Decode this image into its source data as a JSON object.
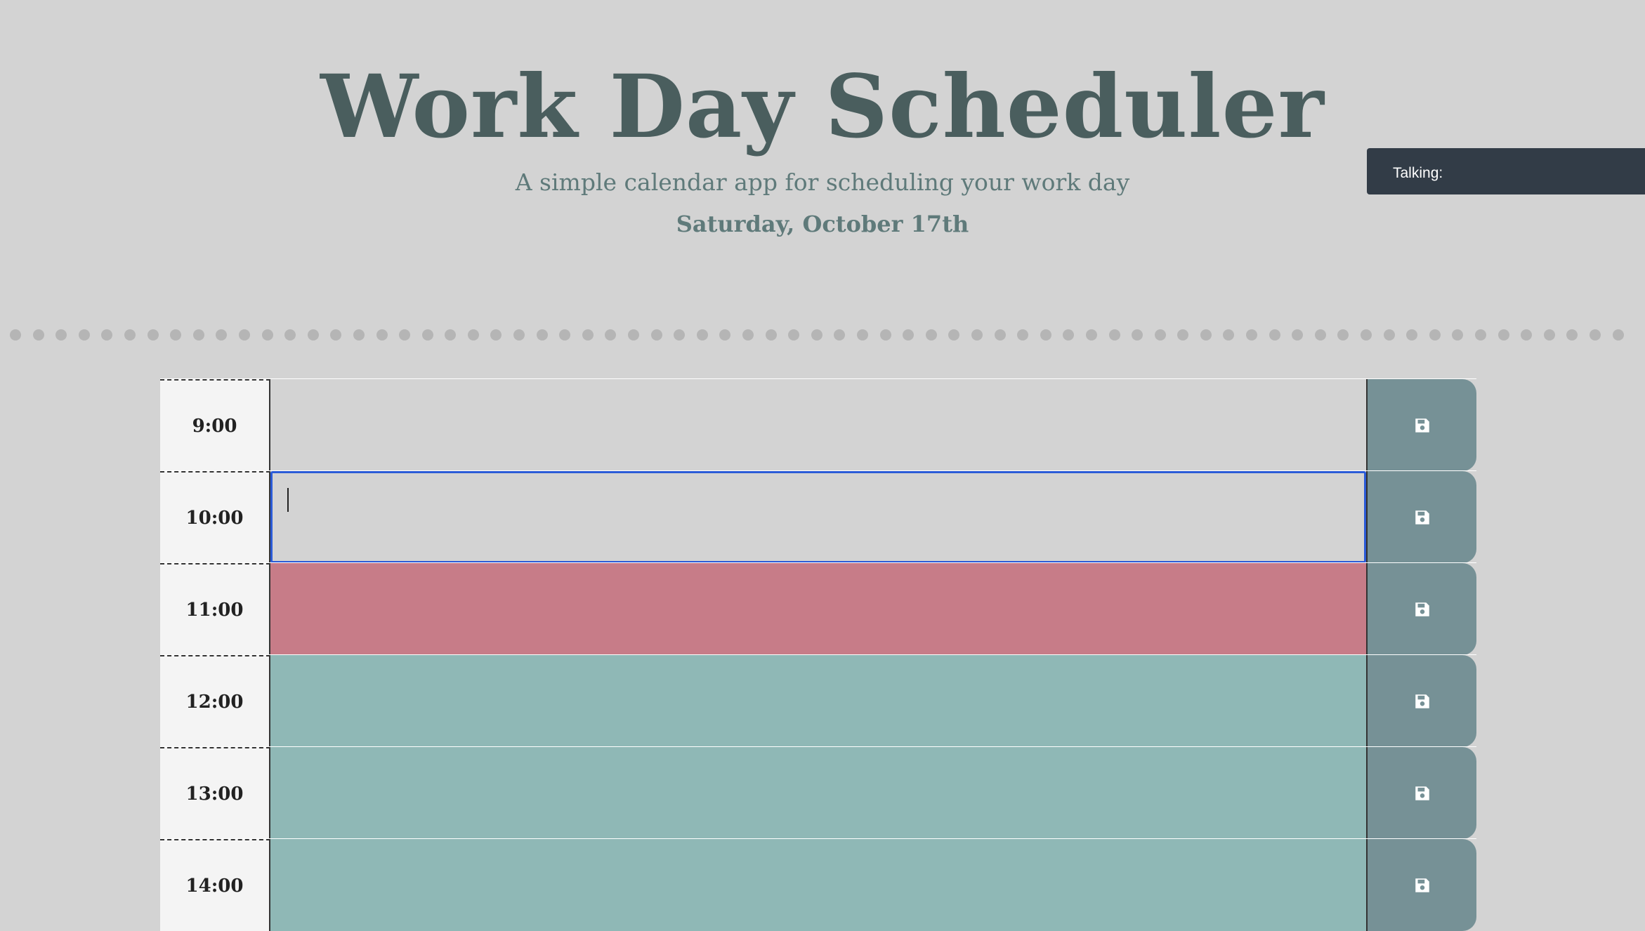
{
  "header": {
    "title": "Work Day Scheduler",
    "subtitle": "A simple calendar app for scheduling your work day",
    "date": "Saturday, October 17th"
  },
  "talk_panel": {
    "label": "Talking:"
  },
  "colors": {
    "past": "#d3d3d3",
    "present": "#c77c88",
    "future": "#8fb8b6",
    "save_button": "#769196",
    "focus_ring": "#2b5bd7"
  },
  "rows": [
    {
      "hour": "9:00",
      "status": "past",
      "text": ""
    },
    {
      "hour": "10:00",
      "status": "past",
      "text": "",
      "focused": true
    },
    {
      "hour": "11:00",
      "status": "present",
      "text": ""
    },
    {
      "hour": "12:00",
      "status": "future",
      "text": ""
    },
    {
      "hour": "13:00",
      "status": "future",
      "text": ""
    },
    {
      "hour": "14:00",
      "status": "future",
      "text": ""
    }
  ],
  "icons": {
    "save": "floppy-disk-icon"
  }
}
